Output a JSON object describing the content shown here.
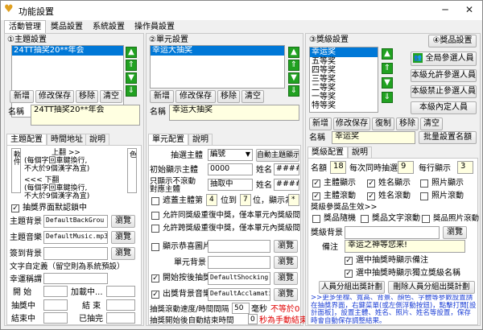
{
  "window": {
    "title": "功能設置",
    "minimize": "─",
    "close": "✕"
  },
  "menus": [
    "活動管理",
    "獎品設置",
    "系統設置",
    "操作員設置"
  ],
  "sections": {
    "theme": "①主題設置",
    "unit": "②單元設置",
    "level": "③獎級設置"
  },
  "theme_list": {
    "items": [
      "24TT抽奖20**年会"
    ]
  },
  "unit_list": {
    "items": [
      "幸运大抽奖"
    ]
  },
  "level_list": {
    "items": [
      "幸运奖",
      "五等奖",
      "四等奖",
      "三等奖",
      "二等奖",
      "一等奖",
      "特等奖"
    ]
  },
  "buttons": {
    "theme": [
      "新增",
      "修改保存",
      "移除",
      "清空"
    ],
    "unit": [
      "新增",
      "修改保存",
      "移除",
      "清空"
    ],
    "level": [
      "新增",
      "修改保存",
      "復制",
      "移除",
      "清空"
    ],
    "prize_setting": "④獎品設置",
    "all_join": "全局參選人員",
    "level_allow": "本級允許參選人員",
    "level_forbid": "本級禁止參選人員",
    "level_internal": "本級內定人員",
    "batch_rename": "批量設置名額",
    "auto_theme_display": "自動主題顯示",
    "browse": "瀏覽",
    "add_level_stats": "人員分組出獎計劃",
    "del_level_stats": "刪除人員分組出獎計劃"
  },
  "theme_form": {
    "name_label": "名稱",
    "name_value": "24TT抽奖20**年会",
    "tabs": [
      "主題配置",
      "時間地址",
      "說明"
    ],
    "vleft": "神州易抽獎軟件",
    "vright": "大地主題特色",
    "hint_up1": "上翻 >>",
    "hint_up2": "(每個字回車鍵換行,",
    "hint_up3": "不大於9個漢字為宜)",
    "hint_dn1": "<<< 下翻",
    "hint_dn2": "(每個字回車鍵換行,",
    "hint_dn3": "不大於9個漢字為宜)",
    "show_default": "抽獎界面默認鎖中",
    "bg_label": "主題背景",
    "bg_value": "DefaultBackGrou",
    "music_label": "主題音樂",
    "music_value": "DefaultMusic.mp3",
    "sign_label": "簽到背景",
    "font_label": "文字自定義（留空則為系統預設）",
    "lucky_label": "幸運稱謂",
    "start_label": "開  始",
    "bonus_label": "加載中...",
    "drawing_label": "抽獎中",
    "end_label": "結  束",
    "finished_label": "結束中",
    "done_label": "已抽完"
  },
  "unit_form": {
    "name_label": "名稱",
    "name_value": "幸运大抽奖",
    "tabs": [
      "單元配置",
      "說明"
    ],
    "draw_theme_label": "抽選主體",
    "draw_theme_value": "編號",
    "initial_label": "初始顯示主體",
    "initial_value": "0000",
    "name2_label": "姓名",
    "name2_value": "####",
    "rolling_label": "只顯示不滾動\n對應主體",
    "rolling_value": "抽取中",
    "name3_label": "姓名",
    "name3_value": "####",
    "cover_label": "遮蓋主體第",
    "cover_from": "4",
    "cover_to_label": "位到",
    "cover_to": "7",
    "cover_show_label": "位，顯示為",
    "cover_mark": "*",
    "allow_dup_cb": "允許同獎級重復中獎，僅本單元內獎級間",
    "allow_dup2_cb": "允許跨獎級重復中獎，僅本單元內獎級間",
    "show_pic_cb": "顯示恭喜圖片",
    "unit_bg_label": "單元背景",
    "start_bg_cb": "開始按後抽獎",
    "start_bg_value": "DefaultShocking.mp3",
    "end_bg_cb": "出獎背景音樂",
    "end_bg_value": "DefaultAcclamation",
    "speed_label": "抽獎滾動速度/時間間隔",
    "speed_value": "50",
    "speed_unit": "毫秒",
    "speed_note": "不等於0",
    "auto_label": "抽獎開始後自動結束時間",
    "auto_value": "0",
    "auto_note": "秒為手動結束"
  },
  "level_form": {
    "name_label": "名稱",
    "name_value": "幸运奖",
    "tabs": [
      "獎級配置",
      "說明"
    ],
    "quota_label": "名額",
    "quota_value": "18",
    "per_label": "每次同時抽選",
    "per_value": "9",
    "row_label": "每行顯示",
    "row_value": "3",
    "cb_theme_show": "主體顯示",
    "cb_name_show": "姓名顯示",
    "cb_photo_show": "照片顯示",
    "cb_theme_roll": "主體滾動",
    "cb_name_roll": "姓名滾動",
    "cb_photo_roll": "照片滾動",
    "prize_info_label": "獎級參獎品生效>>",
    "cb_prize_show": "獎品隨機",
    "cb_prize_text": "獎品文字滾動",
    "cb_prize_pic": "獎品照片滾動",
    "bg_label": "獎級背景",
    "note_label": "備注",
    "note_value": "幸运之神等您来!",
    "cb_choose_show": "選中抽獎時顯示備注",
    "cb_choose_single": "選中抽獎時顯示獨立獎級名稱",
    "info": ">>更多坐標、寬高、背景、顏色、字體等參數設置請在抽獎界面，右鍵菜單(或左側浮動按鈕)，點擊打開[設計面板]，設置主體、姓名、照片、姓名等設置，保存時會自動保存調整結果。"
  },
  "colors": {
    "accent": "#0078d7",
    "yellow": "#ffffe1",
    "green": "#21a121",
    "red": "#e00000",
    "blue": "#1e40d6"
  }
}
